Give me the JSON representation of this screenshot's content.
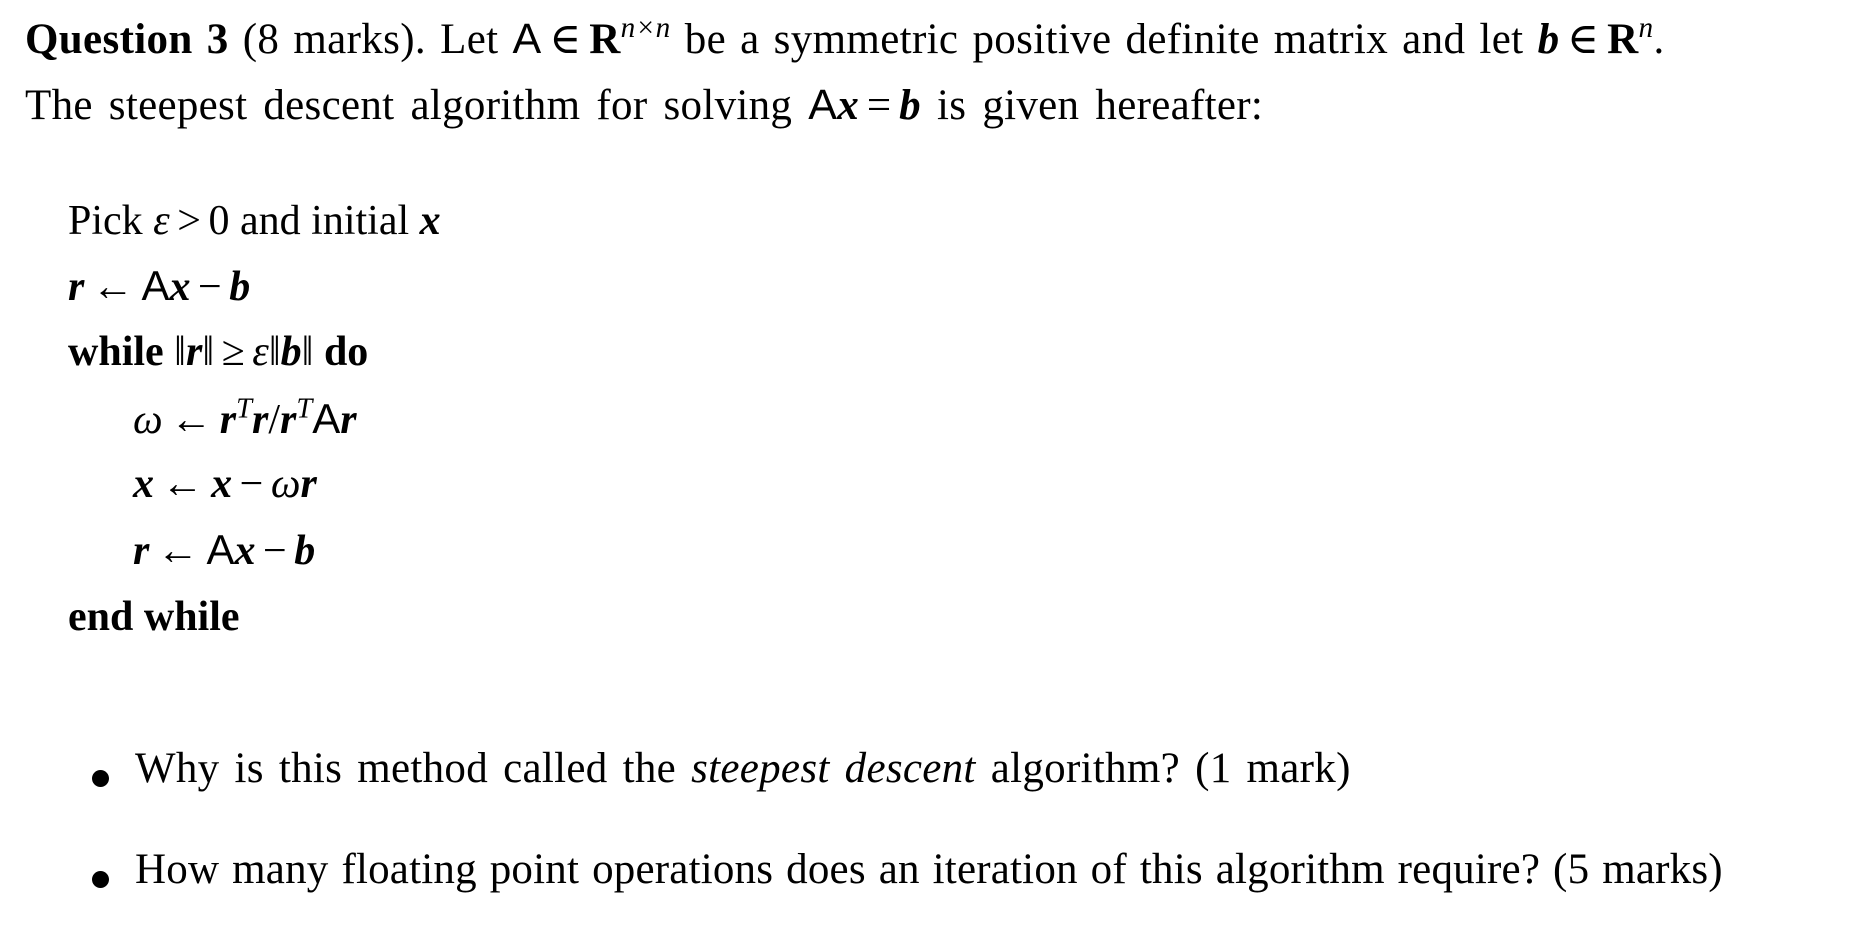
{
  "question": {
    "heading": "Question 3",
    "marks": "(8 marks).",
    "intro_line1": {
      "before_A": "Let",
      "matrix_A": "A",
      "in": "∈",
      "R": "R",
      "R_exp": "n×n",
      "middle": "be a symmetric positive definite matrix and let",
      "vec_b": "b",
      "in2": "∈",
      "R2": "R",
      "R2_exp": "n",
      "end": "."
    },
    "intro_line2": {
      "before": "The steepest descent algorithm for solving",
      "matrix_A": "A",
      "vec_x": "x",
      "eq": "=",
      "vec_b": "b",
      "after": "is given hereafter:"
    }
  },
  "algorithm": {
    "line1": {
      "pick": "Pick",
      "eps": "ε",
      "gt": ">",
      "zero": "0",
      "and_initial": "and initial",
      "x": "x"
    },
    "line2": {
      "r": "r",
      "arrow": "←",
      "A": "A",
      "x": "x",
      "minus": "−",
      "b": "b"
    },
    "line3": {
      "kw_while": "while",
      "norm_r_open": "‖",
      "r": "r",
      "norm_r_close": "‖",
      "geq": "≥",
      "eps": "ε",
      "norm_b_open": "‖",
      "b": "b",
      "norm_b_close": "‖",
      "kw_do": "do"
    },
    "line4": {
      "omega": "ω",
      "arrow": "←",
      "r1": "r",
      "T1": "T",
      "r2": "r",
      "slash": "/",
      "r3": "r",
      "T2": "T",
      "A": "A",
      "r4": "r"
    },
    "line5": {
      "x1": "x",
      "arrow": "←",
      "x2": "x",
      "minus": "−",
      "omega": "ω",
      "r": "r"
    },
    "line6": {
      "r": "r",
      "arrow": "←",
      "A": "A",
      "x": "x",
      "minus": "−",
      "b": "b"
    },
    "line7": {
      "kw_end_while": "end while"
    }
  },
  "subquestions": [
    {
      "before": "Why is this method called the",
      "emph": "steepest descent",
      "after": "algorithm?  (1 mark)"
    },
    {
      "text": "How many floating point operations does an iteration of this algorithm require?  (5 marks)"
    }
  ]
}
